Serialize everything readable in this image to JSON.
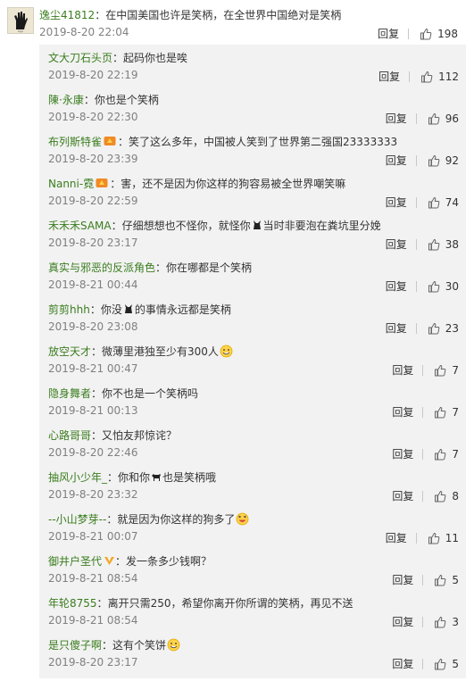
{
  "top_comment": {
    "author": "逸尘41812",
    "separator": "：",
    "text": "在中国美国也许是笑柄，在全世界中国绝对是笑柄",
    "time": "2019-8-20 22:04",
    "reply_label": "回复",
    "likes": "198"
  },
  "replies": [
    {
      "author": "文大刀石头页",
      "sep": "：",
      "text": "起码你也是唉",
      "time": "2019-8-20 22:19",
      "reply_label": "回复",
      "likes": "112"
    },
    {
      "author": "陳·永康",
      "sep": "：",
      "text": "你也是个笑柄",
      "time": "2019-8-20 22:30",
      "reply_label": "回复",
      "likes": "96"
    },
    {
      "author": "布列斯特雀",
      "sep": "：",
      "text": "笑了这么多年，中国被人笑到了世界第二强国23333333",
      "time": "2019-8-20 23:39",
      "reply_label": "回复",
      "likes": "92"
    },
    {
      "author": "Nanni-霓",
      "sep": "：",
      "text": "害，还不是因为你这样的狗容易被全世界嘲笑嘛",
      "time": "2019-8-20 22:59",
      "reply_label": "回复",
      "likes": "74"
    },
    {
      "author": "禾禾禾SAMA",
      "sep": "：",
      "text_a": "仔细想想也不怪你，就怪你",
      "text_b": "当时非要泡在粪坑里分娩",
      "time": "2019-8-20 23:17",
      "reply_label": "回复",
      "likes": "38"
    },
    {
      "author": "真实与邪恶的反派角色",
      "sep": "：",
      "text": "你在哪都是个笑柄",
      "time": "2019-8-21 00:44",
      "reply_label": "回复",
      "likes": "30"
    },
    {
      "author": "剪剪hhh",
      "sep": "：",
      "text_a": "你没",
      "text_b": "的事情永远都是笑柄",
      "time": "2019-8-20 23:08",
      "reply_label": "回复",
      "likes": "23"
    },
    {
      "author": "放空天才",
      "sep": "：",
      "text": "微薄里港独至少有300人",
      "time": "2019-8-21 00:47",
      "reply_label": "回复",
      "likes": "7"
    },
    {
      "author": "隐身舞者",
      "sep": "：",
      "text": "你不也是一个笑柄吗",
      "time": "2019-8-21 00:13",
      "reply_label": "回复",
      "likes": "7"
    },
    {
      "author": "心路哥哥",
      "sep": "：",
      "text": "又怕友邦惊诧？",
      "time": "2019-8-20 22:46",
      "reply_label": "回复",
      "likes": "7"
    },
    {
      "author": "抽风小少年_",
      "sep": "：",
      "text_a": "你和你",
      "text_b": "也是笑柄哦",
      "time": "2019-8-20 23:32",
      "reply_label": "回复",
      "likes": "8"
    },
    {
      "author": "--小山梦芽--",
      "sep": "：",
      "text": "就是因为你这样的狗多了",
      "time": "2019-8-21 00:07",
      "reply_label": "回复",
      "likes": "11"
    },
    {
      "author": "御井户圣代",
      "sep": "：",
      "text": "发一条多少钱啊？",
      "time": "2019-8-21 08:54",
      "reply_label": "回复",
      "likes": "5"
    },
    {
      "author": "年轮8755",
      "sep": "：",
      "text": "离开只需250，希望你离开你所谓的笑柄，再见不送",
      "time": "2019-8-21 08:54",
      "reply_label": "回复",
      "likes": "3"
    },
    {
      "author": "是只傻子啊",
      "sep": "：",
      "text": "这有个笑饼",
      "time": "2019-8-20 23:17",
      "reply_label": "回复",
      "likes": "5"
    }
  ],
  "colors": {
    "author": "#3a7d1e",
    "meta": "#808080",
    "reply_bg": "#f2f2f2",
    "text": "#333333"
  },
  "icons": {
    "like": "thumbs-up-icon",
    "vip": "vip-badge-icon",
    "emoji": "grin-emoji-icon"
  }
}
